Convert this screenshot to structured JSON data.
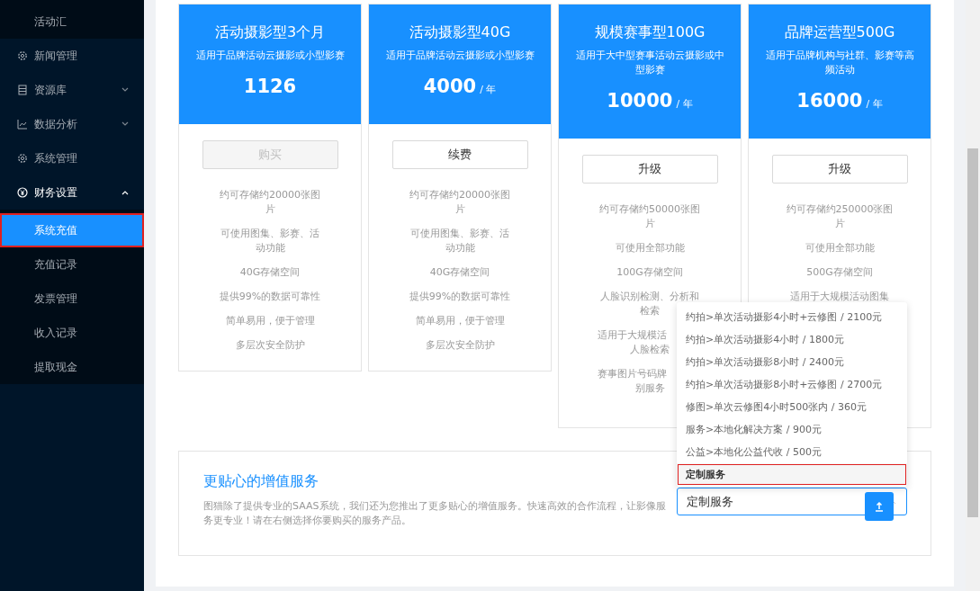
{
  "sidebar": {
    "items": [
      {
        "label": "活动汇",
        "selected": false
      },
      {
        "label": "新闻管理"
      },
      {
        "label": "资源库",
        "expanded": false
      },
      {
        "label": "数据分析",
        "expanded": false
      },
      {
        "label": "系统管理"
      },
      {
        "label": "财务设置",
        "expanded": true,
        "children": [
          {
            "label": "系统充值",
            "selected": true
          },
          {
            "label": "充值记录",
            "selected": false
          },
          {
            "label": "发票管理",
            "selected": false
          },
          {
            "label": "收入记录",
            "selected": false
          },
          {
            "label": "提取现金",
            "selected": false
          }
        ]
      }
    ]
  },
  "plans": [
    {
      "title": "活动摄影型3个月",
      "subtitle": "适用于品牌活动云摄影或小型影赛",
      "price": "1126",
      "button": {
        "label": "购买",
        "disabled": true
      },
      "features": [
        "约可存储约20000张图片",
        "可使用图集、影赛、活动功能",
        "40G存储空间",
        "提供99%的数据可靠性",
        "简单易用，便于管理",
        "多层次安全防护"
      ]
    },
    {
      "title": "活动摄影型40G",
      "subtitle": "适用于品牌活动云摄影或小型影赛",
      "price": "4000",
      "unit": "/ 年",
      "button": {
        "label": "续费",
        "disabled": false
      },
      "features": [
        "约可存储约20000张图片",
        "可使用图集、影赛、活动功能",
        "40G存储空间",
        "提供99%的数据可靠性",
        "简单易用，便于管理",
        "多层次安全防护"
      ]
    },
    {
      "title": "规模赛事型100G",
      "subtitle": "适用于大中型赛事活动云摄影或中型影赛",
      "price": "10000",
      "unit": "/ 年",
      "button": {
        "label": "升级",
        "disabled": false
      },
      "features": [
        "约可存储约50000张图片",
        "可使用全部功能",
        "100G存储空间",
        "人脸识别检测、分析和检索",
        [
          "适用于大规模活",
          "人脸检索"
        ],
        [
          "赛事图片号码牌",
          "别服务"
        ]
      ]
    },
    {
      "title": "品牌运营型500G",
      "subtitle": "适用于品牌机构与社群、影赛等高频活动",
      "price": "16000",
      "unit": "/ 年",
      "button": {
        "label": "升级",
        "disabled": false
      },
      "features": [
        "约可存储约250000张图片",
        "可使用全部功能",
        "500G存储空间",
        "适用于大规模活动图集"
      ]
    }
  ],
  "service": {
    "title": "更贴心的增值服务",
    "description": "图猫除了提供专业的SAAS系统，我们还为您推出了更多贴心的增值服务。快速高效的合作流程，让影像服务更专业！请在右侧选择你要购买的服务产品。",
    "select": {
      "value": "定制服务",
      "expanded": true
    },
    "options": [
      {
        "label": "约拍>单次活动摄影4小时+云修图 / 2100元",
        "selected": false
      },
      {
        "label": "约拍>单次活动摄影4小时 / 1800元",
        "selected": false
      },
      {
        "label": "约拍>单次活动摄影8小时 / 2400元",
        "selected": false
      },
      {
        "label": "约拍>单次活动摄影8小时+云修图 / 2700元",
        "selected": false
      },
      {
        "label": "修图>单次云修图4小时500张内 / 360元",
        "selected": false
      },
      {
        "label": "服务>本地化解决方案 / 900元",
        "selected": false
      },
      {
        "label": "公益>本地化公益代收 / 500元",
        "selected": false
      },
      {
        "label": "定制服务",
        "selected": true
      }
    ]
  }
}
